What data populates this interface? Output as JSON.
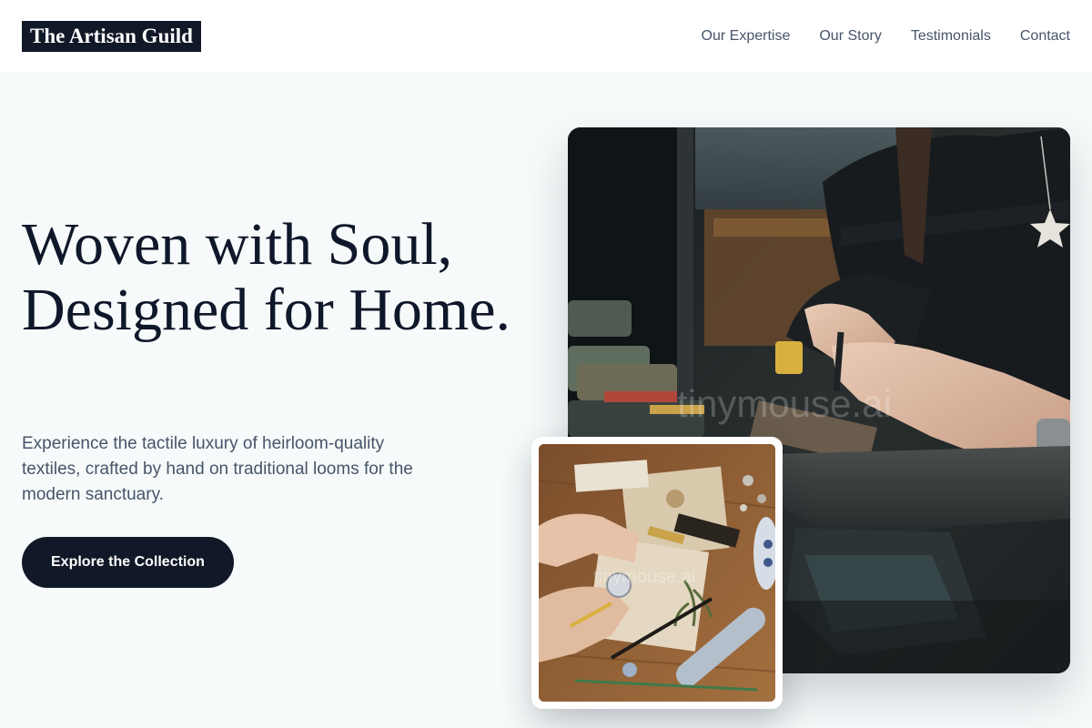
{
  "header": {
    "logo": "The Artisan Guild",
    "nav": [
      {
        "label": "Our Expertise"
      },
      {
        "label": "Our Story"
      },
      {
        "label": "Testimonials"
      },
      {
        "label": "Contact"
      }
    ]
  },
  "hero": {
    "title": "Woven with Soul, Designed for Home.",
    "subtitle": "Experience the tactile luxury of heirloom-quality textiles, crafted by hand on traditional looms for the modern sanctuary.",
    "cta_label": "Explore the Collection"
  },
  "images": {
    "main_watermark": "tinymouse.ai",
    "inset_watermark": "tinymouse.ai"
  },
  "colors": {
    "page_bg": "#f6fafa",
    "primary": "#111827",
    "heading": "#0f172a",
    "body_text": "#475569"
  }
}
